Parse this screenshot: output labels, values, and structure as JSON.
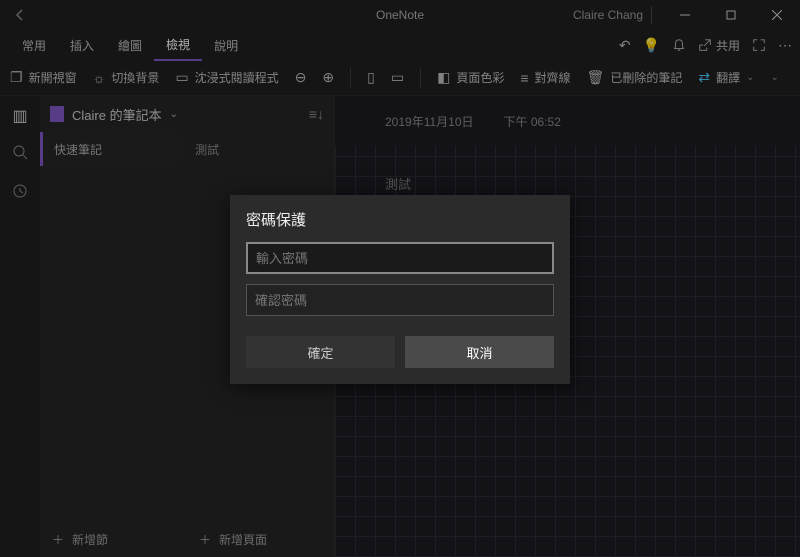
{
  "app": {
    "title": "OneNote",
    "user": "Claire Chang"
  },
  "tabs": {
    "home": "常用",
    "insert": "插入",
    "draw": "繪圖",
    "view": "檢視",
    "help": "說明",
    "share": "共用"
  },
  "toolbar": {
    "new_window": "新開視窗",
    "switch_bg": "切換背景",
    "immersive": "沈浸式閱讀程式",
    "page_color": "頁面色彩",
    "rule_lines": "對齊線",
    "deleted_notes": "已刪除的筆記",
    "translate": "翻譯"
  },
  "notebook": {
    "name": "Claire 的筆記本"
  },
  "sections": {
    "item0": "快速筆記"
  },
  "pages": {
    "item0": "測試"
  },
  "page": {
    "date": "2019年11月10日",
    "time": "下午 06:52",
    "title": "測試"
  },
  "footer": {
    "add_section": "新增節",
    "add_page": "新增頁面"
  },
  "dialog": {
    "title": "密碼保護",
    "placeholder1": "輸入密碼",
    "placeholder2": "確認密碼",
    "ok": "確定",
    "cancel": "取消"
  }
}
